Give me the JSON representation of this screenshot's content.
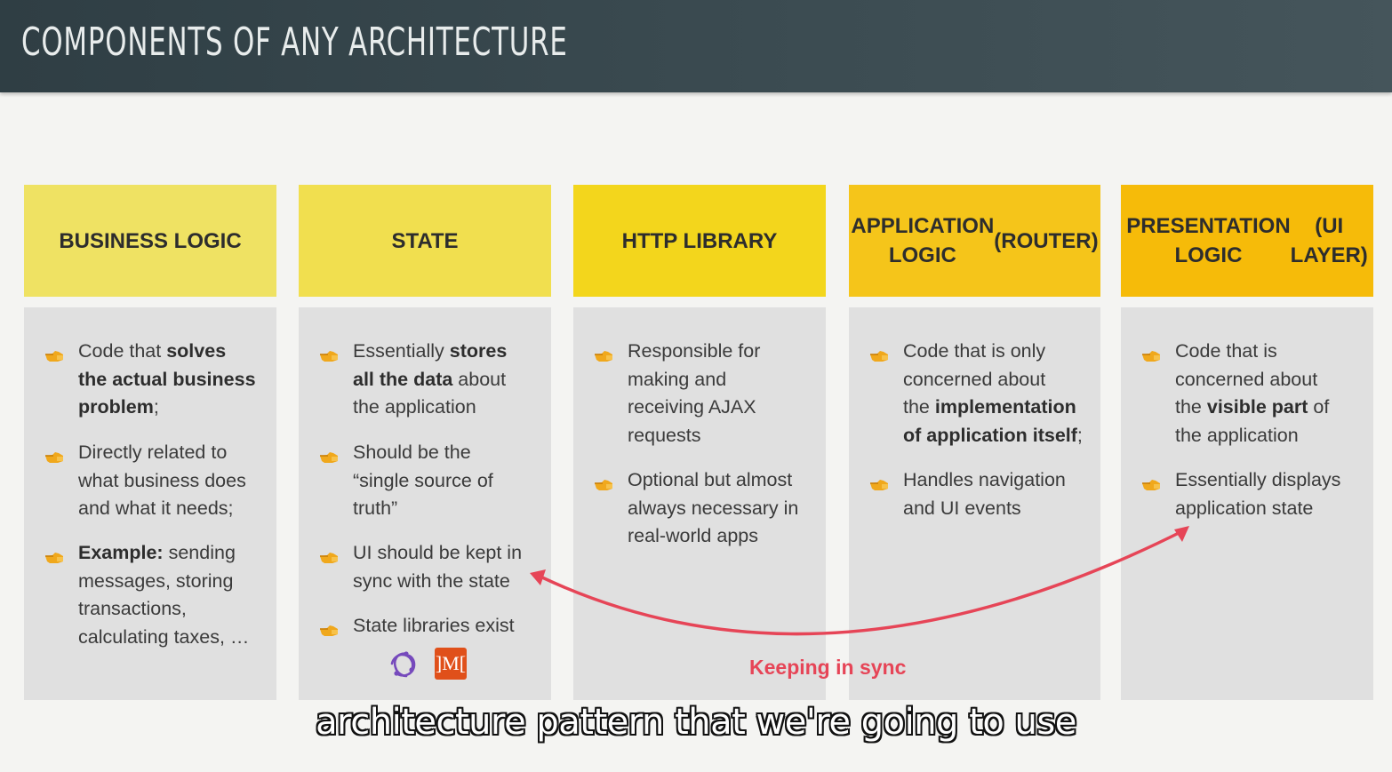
{
  "slide": {
    "title": "COMPONENTS OF ANY ARCHITECTURE"
  },
  "columns": [
    {
      "heading_lines": [
        "BUSINESS LOGIC"
      ],
      "bullets": [
        [
          {
            "t": "Code that "
          },
          {
            "t": "solves",
            "b": true
          },
          {
            "t": "\n"
          },
          {
            "t": "the actual business",
            "b": true
          },
          {
            "t": "\n"
          },
          {
            "t": "problem",
            "b": true
          },
          {
            "t": ";"
          }
        ],
        [
          {
            "t": "Directly related to\nwhat business does\nand what it needs;"
          }
        ],
        [
          {
            "t": "Example:",
            "b": true
          },
          {
            "t": " sending\nmessages, storing\ntransactions,\ncalculating taxes, …"
          }
        ]
      ]
    },
    {
      "heading_lines": [
        "STATE"
      ],
      "bullets": [
        [
          {
            "t": "Essentially "
          },
          {
            "t": "stores",
            "b": true
          },
          {
            "t": "\n"
          },
          {
            "t": "all the data",
            "b": true
          },
          {
            "t": " about\nthe application"
          }
        ],
        [
          {
            "t": "Should be the\n“single source of\ntruth”"
          }
        ],
        [
          {
            "t": "UI should be kept in\nsync with the state"
          }
        ],
        [
          {
            "t": "State libraries exist"
          }
        ]
      ]
    },
    {
      "heading_lines": [
        "HTTP LIBRARY"
      ],
      "bullets": [
        [
          {
            "t": "Responsible for\nmaking and\nreceiving AJAX\nrequests"
          }
        ],
        [
          {
            "t": "Optional but almost\nalways necessary in\nreal-world apps"
          }
        ]
      ]
    },
    {
      "heading_lines": [
        "APPLICATION LOGIC",
        "(ROUTER)"
      ],
      "bullets": [
        [
          {
            "t": "Code that is only\nconcerned about\nthe "
          },
          {
            "t": "implementation",
            "b": true
          },
          {
            "t": "\n"
          },
          {
            "t": "of application itself",
            "b": true
          },
          {
            "t": ";"
          }
        ],
        [
          {
            "t": "Handles navigation\nand UI events"
          }
        ]
      ]
    },
    {
      "heading_lines": [
        "PRESENTATION LOGIC",
        "(UI LAYER)"
      ],
      "bullets": [
        [
          {
            "t": "Code that is\nconcerned about\nthe "
          },
          {
            "t": "visible part",
            "b": true
          },
          {
            "t": " of\nthe application"
          }
        ],
        [
          {
            "t": "Essentially displays\napplication state"
          }
        ]
      ]
    }
  ],
  "state_libraries": {
    "icons": [
      "redux-icon",
      "mobx-icon"
    ],
    "mobx_glyph": "]M["
  },
  "sync_arrow": {
    "label": "Keeping in sync",
    "color": "#e64557"
  },
  "caption": {
    "text": "architecture pattern that we're going to use"
  },
  "colors": {
    "header_bg": "#37474d",
    "head_1": "#efe263",
    "head_2": "#f1df4f",
    "head_3": "#f3d61c",
    "head_4": "#f5c51a",
    "head_5": "#f6bb09",
    "body_bg": "#e0e0e0"
  }
}
